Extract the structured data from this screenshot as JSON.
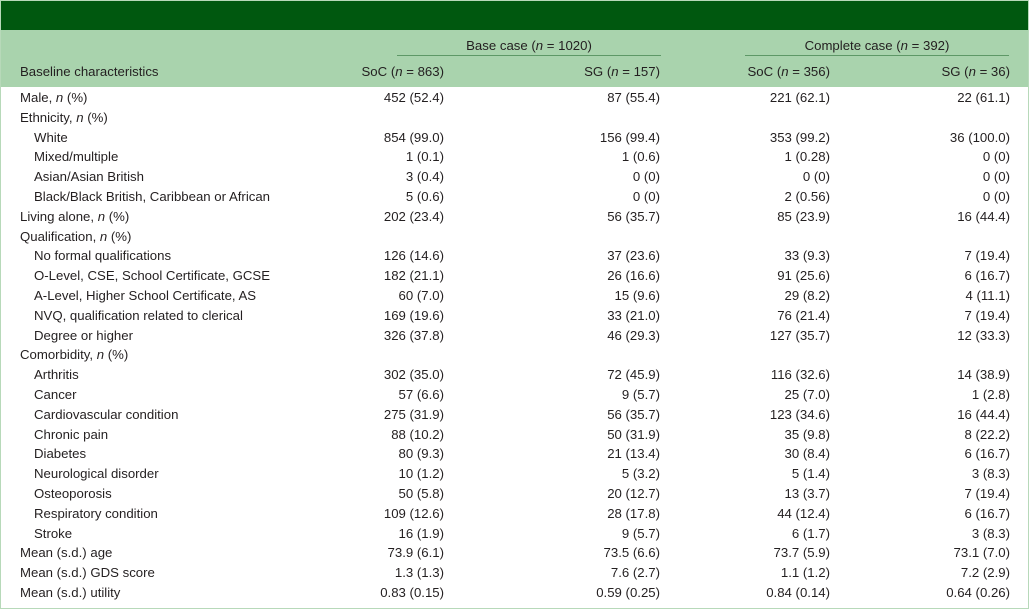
{
  "groups": [
    {
      "pre": "Base case (",
      "var": "n",
      "post": " = 1020)"
    },
    {
      "pre": "Complete case (",
      "var": "n",
      "post": " = 392)"
    }
  ],
  "columns": {
    "label": "Baseline characteristics",
    "headers": [
      {
        "pre": "SoC (",
        "var": "n",
        "post": " = 863)"
      },
      {
        "pre": "SG (",
        "var": "n",
        "post": " = 157)"
      },
      {
        "pre": "SoC (",
        "var": "n",
        "post": " = 356)"
      },
      {
        "pre": "SG (",
        "var": "n",
        "post": " = 36)"
      }
    ]
  },
  "rows": [
    {
      "label": "Male, ",
      "var": "n",
      "post": " (%)",
      "child": false,
      "values": [
        "452 (52.4)",
        "87 (55.4)",
        "221 (62.1)",
        "22 (61.1)"
      ]
    },
    {
      "label": "Ethnicity, ",
      "var": "n",
      "post": " (%)",
      "child": false,
      "values": [
        "",
        "",
        "",
        ""
      ]
    },
    {
      "label": "White",
      "var": "",
      "post": "",
      "child": true,
      "values": [
        "854 (99.0)",
        "156 (99.4)",
        "353 (99.2)",
        "36 (100.0)"
      ]
    },
    {
      "label": "Mixed/multiple",
      "var": "",
      "post": "",
      "child": true,
      "values": [
        "1 (0.1)",
        "1 (0.6)",
        "1 (0.28)",
        "0 (0)"
      ]
    },
    {
      "label": "Asian/Asian British",
      "var": "",
      "post": "",
      "child": true,
      "values": [
        "3 (0.4)",
        "0 (0)",
        "0 (0)",
        "0 (0)"
      ]
    },
    {
      "label": "Black/Black British, Caribbean or African",
      "var": "",
      "post": "",
      "child": true,
      "values": [
        "5 (0.6)",
        "0 (0)",
        "2 (0.56)",
        "0 (0)"
      ]
    },
    {
      "label": "Living alone, ",
      "var": "n",
      "post": " (%)",
      "child": false,
      "values": [
        "202 (23.4)",
        "56 (35.7)",
        "85 (23.9)",
        "16 (44.4)"
      ]
    },
    {
      "label": "Qualification, ",
      "var": "n",
      "post": " (%)",
      "child": false,
      "values": [
        "",
        "",
        "",
        ""
      ]
    },
    {
      "label": "No formal qualifications",
      "var": "",
      "post": "",
      "child": true,
      "values": [
        "126 (14.6)",
        "37 (23.6)",
        "33 (9.3)",
        "7 (19.4)"
      ]
    },
    {
      "label": "O-Level, CSE, School Certificate, GCSE",
      "var": "",
      "post": "",
      "child": true,
      "values": [
        "182 (21.1)",
        "26 (16.6)",
        "91 (25.6)",
        "6 (16.7)"
      ]
    },
    {
      "label": "A-Level, Higher School Certificate, AS",
      "var": "",
      "post": "",
      "child": true,
      "values": [
        "60 (7.0)",
        "15 (9.6)",
        "29 (8.2)",
        "4 (11.1)"
      ]
    },
    {
      "label": "NVQ, qualification related to clerical",
      "var": "",
      "post": "",
      "child": true,
      "values": [
        "169 (19.6)",
        "33 (21.0)",
        "76 (21.4)",
        "7 (19.4)"
      ]
    },
    {
      "label": "Degree or higher",
      "var": "",
      "post": "",
      "child": true,
      "values": [
        "326 (37.8)",
        "46 (29.3)",
        "127 (35.7)",
        "12 (33.3)"
      ]
    },
    {
      "label": "Comorbidity, ",
      "var": "n",
      "post": " (%)",
      "child": false,
      "values": [
        "",
        "",
        "",
        ""
      ]
    },
    {
      "label": "Arthritis",
      "var": "",
      "post": "",
      "child": true,
      "values": [
        "302 (35.0)",
        "72 (45.9)",
        "116 (32.6)",
        "14 (38.9)"
      ]
    },
    {
      "label": "Cancer",
      "var": "",
      "post": "",
      "child": true,
      "values": [
        "57 (6.6)",
        "9 (5.7)",
        "25 (7.0)",
        "1 (2.8)"
      ]
    },
    {
      "label": "Cardiovascular condition",
      "var": "",
      "post": "",
      "child": true,
      "values": [
        "275 (31.9)",
        "56 (35.7)",
        "123 (34.6)",
        "16 (44.4)"
      ]
    },
    {
      "label": "Chronic pain",
      "var": "",
      "post": "",
      "child": true,
      "values": [
        "88 (10.2)",
        "50 (31.9)",
        "35 (9.8)",
        "8 (22.2)"
      ]
    },
    {
      "label": "Diabetes",
      "var": "",
      "post": "",
      "child": true,
      "values": [
        "80 (9.3)",
        "21 (13.4)",
        "30 (8.4)",
        "6 (16.7)"
      ]
    },
    {
      "label": "Neurological disorder",
      "var": "",
      "post": "",
      "child": true,
      "values": [
        "10 (1.2)",
        "5 (3.2)",
        "5 (1.4)",
        "3 (8.3)"
      ]
    },
    {
      "label": "Osteoporosis",
      "var": "",
      "post": "",
      "child": true,
      "values": [
        "50 (5.8)",
        "20 (12.7)",
        "13 (3.7)",
        "7 (19.4)"
      ]
    },
    {
      "label": "Respiratory condition",
      "var": "",
      "post": "",
      "child": true,
      "values": [
        "109 (12.6)",
        "28 (17.8)",
        "44 (12.4)",
        "6 (16.7)"
      ]
    },
    {
      "label": "Stroke",
      "var": "",
      "post": "",
      "child": true,
      "values": [
        "16 (1.9)",
        "9 (5.7)",
        "6 (1.7)",
        "3 (8.3)"
      ]
    },
    {
      "label": "Mean (s.d.) age",
      "var": "",
      "post": "",
      "child": false,
      "values": [
        "73.9 (6.1)",
        "73.5 (6.6)",
        "73.7 (5.9)",
        "73.1 (7.0)"
      ]
    },
    {
      "label": "Mean (s.d.) GDS score",
      "var": "",
      "post": "",
      "child": false,
      "values": [
        "1.3 (1.3)",
        "7.6 (2.7)",
        "1.1 (1.2)",
        "7.2 (2.9)"
      ]
    },
    {
      "label": "Mean (s.d.) utility",
      "var": "",
      "post": "",
      "child": false,
      "values": [
        "0.83 (0.15)",
        "0.59 (0.25)",
        "0.84 (0.14)",
        "0.64 (0.26)"
      ]
    }
  ],
  "colors": {
    "header_bar": "#00580f",
    "header_band": "#a9d3ad",
    "rule": "#5e9867"
  }
}
